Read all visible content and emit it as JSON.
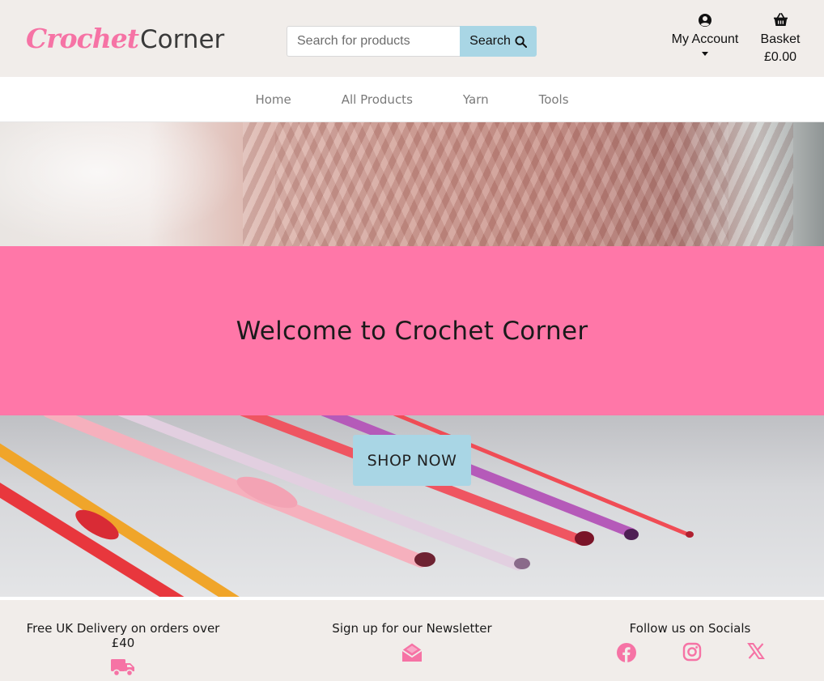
{
  "header": {
    "logo_part1": "Crochet",
    "logo_part2": "Corner",
    "search_placeholder": "Search for products",
    "search_button": "Search",
    "account_label": "My Account",
    "basket_label": "Basket",
    "basket_total": "£0.00"
  },
  "nav": {
    "items": [
      {
        "label": "Home"
      },
      {
        "label": "All Products"
      },
      {
        "label": "Yarn"
      },
      {
        "label": "Tools"
      }
    ]
  },
  "hero": {
    "welcome_text": "Welcome to Crochet Corner",
    "shop_button": "SHOP NOW"
  },
  "footer": {
    "delivery_text": "Free UK Delivery on orders over £40",
    "newsletter_text": "Sign up for our Newsletter",
    "socials_text": "Follow us on Socials",
    "icons": [
      "truck-icon",
      "envelope-open-icon",
      "facebook-icon",
      "instagram-icon",
      "x-twitter-icon"
    ]
  },
  "colors": {
    "brand_pink": "#ff77a8",
    "logo_pink": "#f673a5",
    "accent_blue": "#a9d6e5",
    "background": "#f1edea"
  }
}
